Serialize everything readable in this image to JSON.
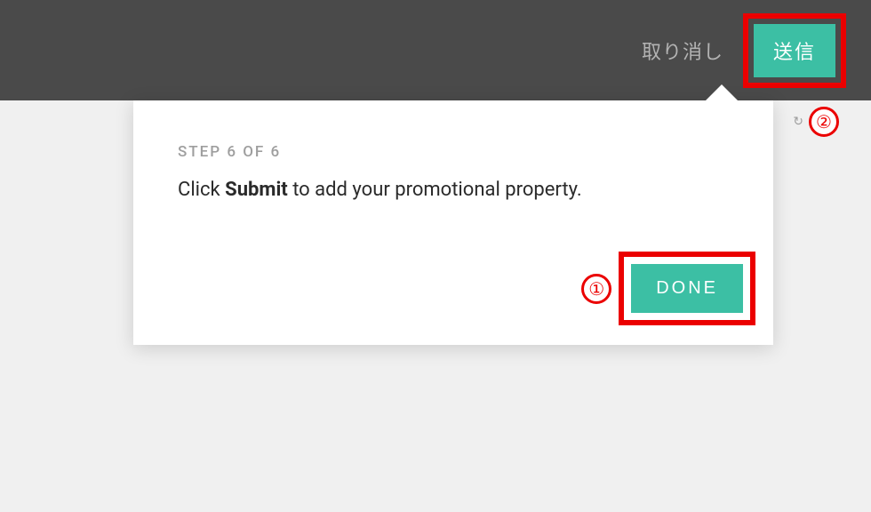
{
  "header": {
    "cancel_label": "取り消し",
    "submit_label": "送信"
  },
  "tooltip": {
    "step_label": "STEP 6 OF 6",
    "instruction_prefix": "Click ",
    "instruction_bold": "Submit",
    "instruction_suffix": " to add your promotional property.",
    "done_label": "DONE"
  },
  "annotations": {
    "one": "①",
    "two": "②",
    "reload_hint": "↻"
  }
}
